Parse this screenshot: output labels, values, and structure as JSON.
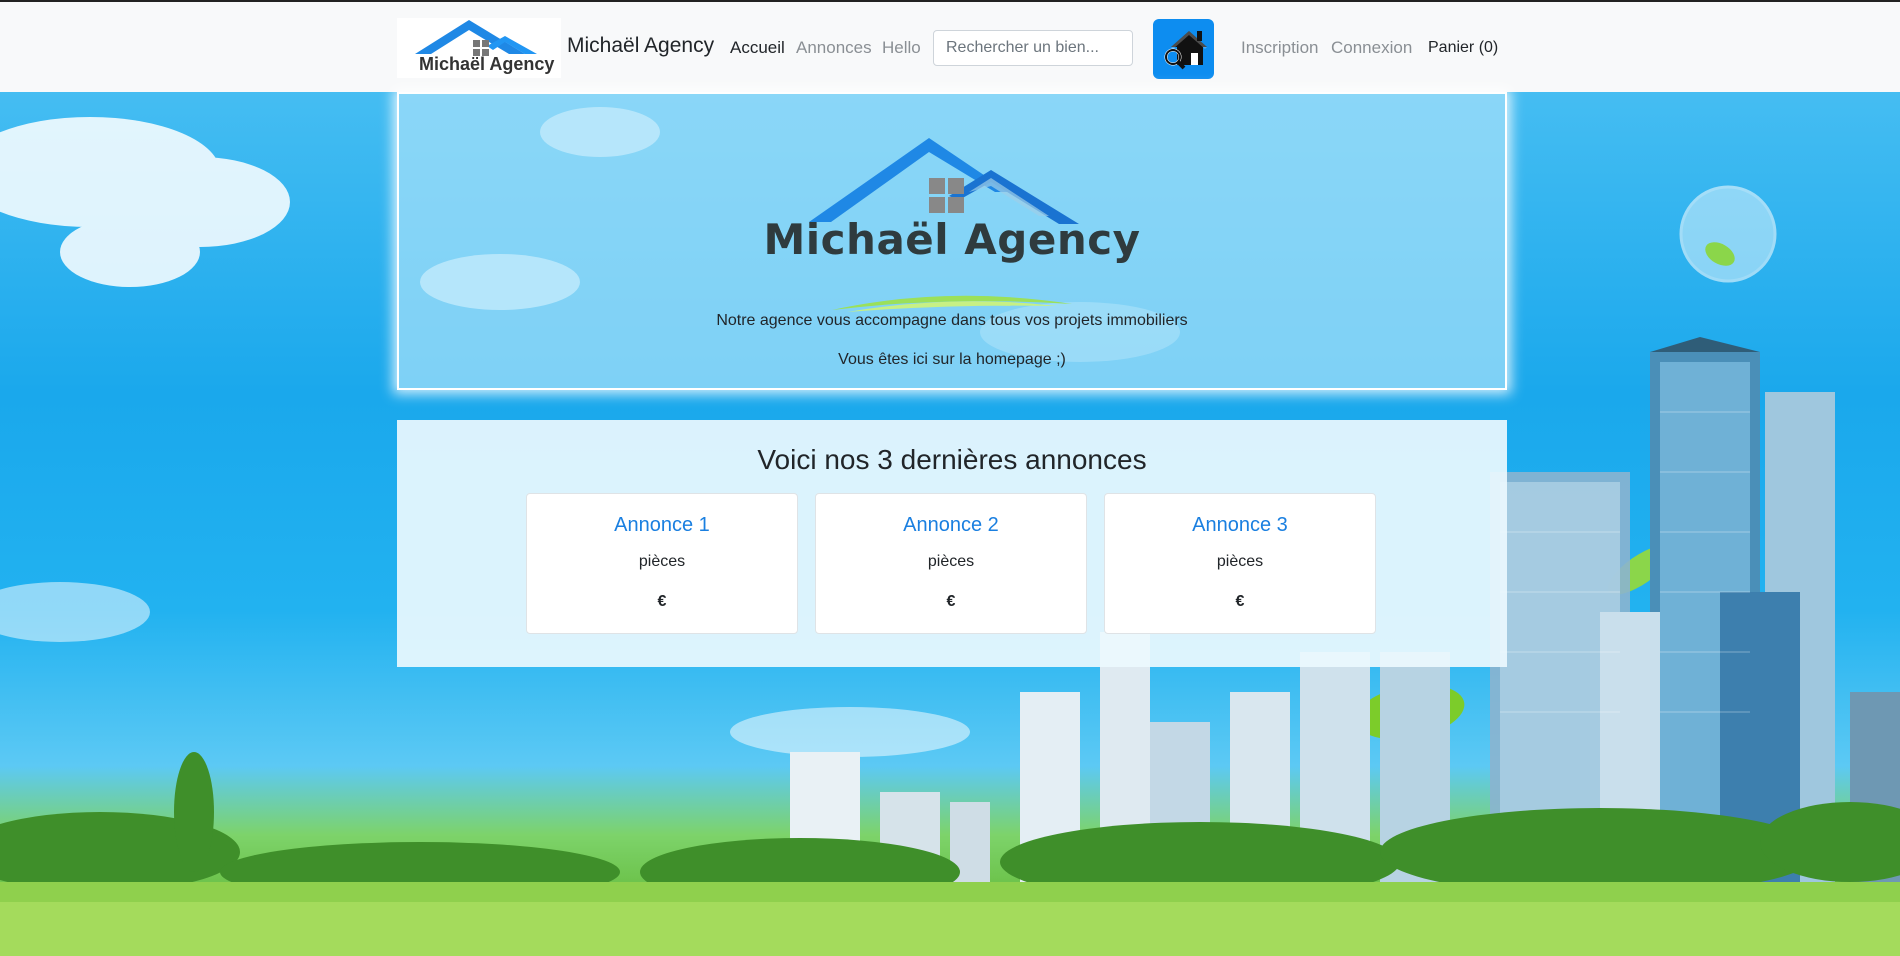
{
  "navbar": {
    "logo_text": "Michaël Agency",
    "brand_name": "Michaël Agency",
    "links": {
      "home": "Accueil",
      "listings": "Annonces",
      "hello": "Hello",
      "register": "Inscription",
      "login": "Connexion",
      "cart": "Panier (0)"
    },
    "search_placeholder": "Rechercher un bien..."
  },
  "jumbotron": {
    "title": "Michaël Agency",
    "tagline": "Notre agence vous accompagne dans tous vos projets immobiliers",
    "subtext": "Vous êtes ici sur la homepage ;)"
  },
  "listings": {
    "title": "Voici nos 3 dernières annonces",
    "cards": [
      {
        "title": "Annonce 1",
        "rooms": "pièces",
        "price": "€"
      },
      {
        "title": "Annonce 2",
        "rooms": "pièces",
        "price": "€"
      },
      {
        "title": "Annonce 3",
        "rooms": "pièces",
        "price": "€"
      }
    ]
  },
  "colors": {
    "accent": "#0d8df0",
    "link": "#1a7fe0",
    "navbar_bg": "#f8f9fa"
  }
}
